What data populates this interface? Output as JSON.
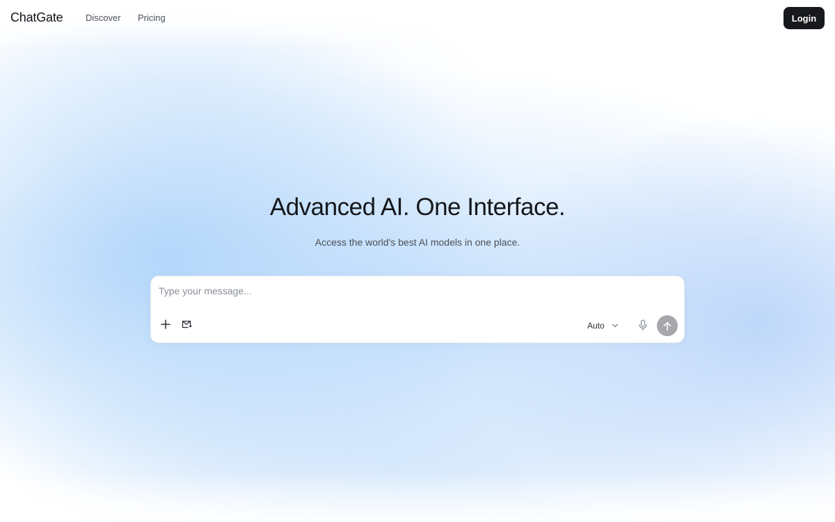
{
  "header": {
    "logo": "ChatGate",
    "nav": [
      {
        "label": "Discover"
      },
      {
        "label": "Pricing"
      }
    ],
    "login_label": "Login"
  },
  "hero": {
    "title": "Advanced AI. One Interface.",
    "subtitle": "Access the world's best AI models in one place."
  },
  "composer": {
    "placeholder": "Type your message...",
    "value": "",
    "model": "Auto",
    "icons": {
      "attach": "plus-icon",
      "mail": "mail-icon",
      "dropdown": "chevron-down-icon",
      "mic": "microphone-icon",
      "send": "arrow-up-icon"
    }
  },
  "colors": {
    "login_bg": "#18191c",
    "send_bg": "#a5a7ab",
    "gradient_blue": "#c4dffc"
  }
}
